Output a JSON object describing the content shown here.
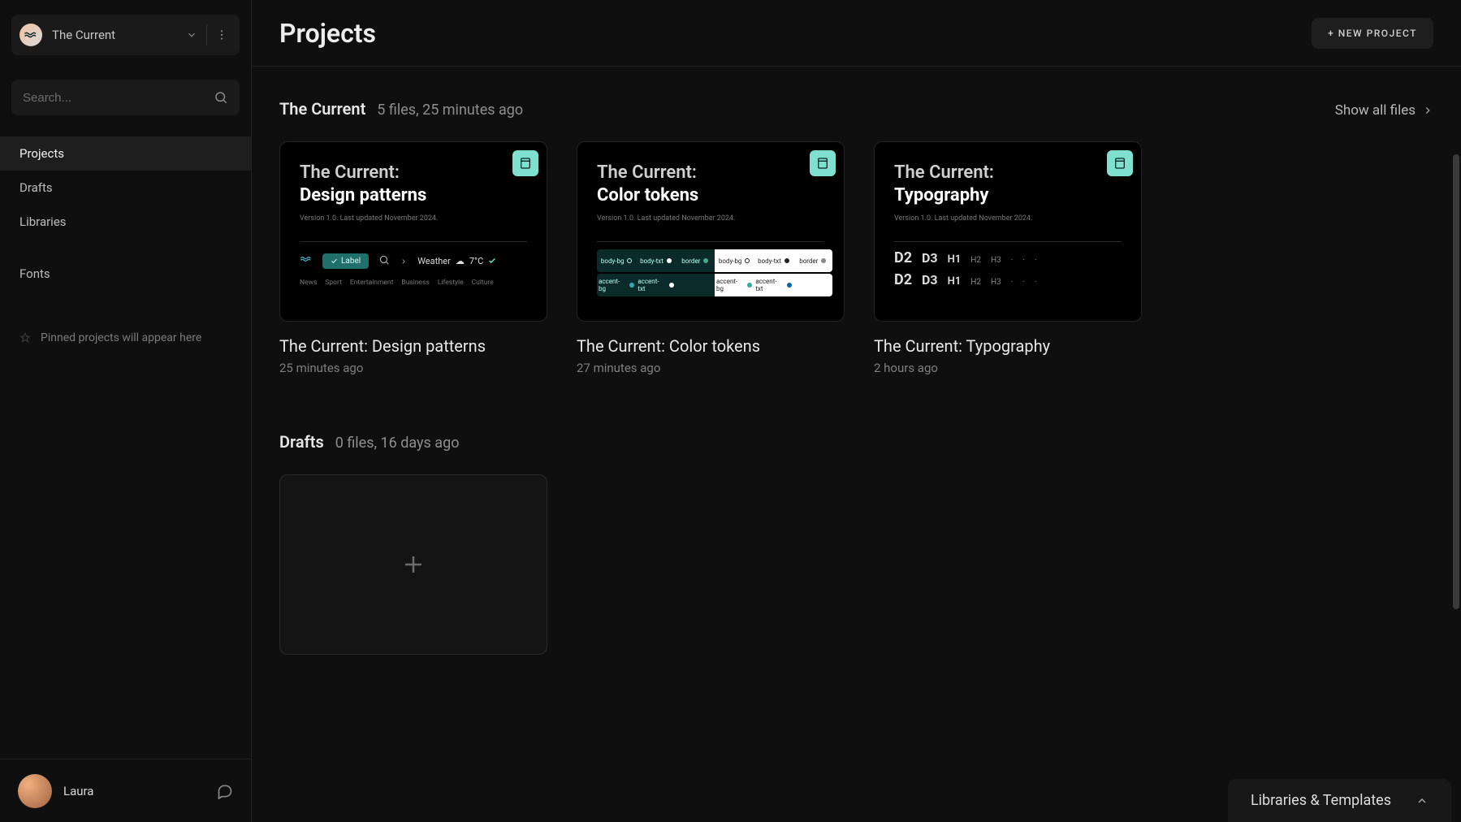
{
  "workspace": {
    "name": "The Current"
  },
  "search": {
    "placeholder": "Search..."
  },
  "nav": {
    "projects": "Projects",
    "drafts": "Drafts",
    "libraries": "Libraries",
    "fonts": "Fonts"
  },
  "pinned": {
    "empty_text": "Pinned projects will appear here"
  },
  "user": {
    "name": "Laura"
  },
  "header": {
    "title": "Projects",
    "new_project_label": "+ NEW PROJECT"
  },
  "sections": {
    "current": {
      "title": "The Current",
      "files_count": "5 files,",
      "updated": "25 minutes ago",
      "show_all": "Show all files"
    },
    "drafts": {
      "title": "Drafts",
      "files_count": "0 files,",
      "updated": "16 days ago"
    }
  },
  "cards": [
    {
      "thumb_line1": "The Current:",
      "thumb_line2": "Design patterns",
      "thumb_version": "Version 1.0. Last updated November 2024.",
      "title": "The Current: Design patterns",
      "subtitle": "25 minutes ago",
      "dp_label": "Label",
      "dp_weather": "Weather",
      "dp_temp": "7°C",
      "dp_tags": [
        "News",
        "Sport",
        "Entertainment",
        "Business",
        "Lifestyle",
        "Culture"
      ]
    },
    {
      "thumb_line1": "The Current:",
      "thumb_line2": "Color tokens",
      "thumb_version": "Version 1.0. Last updated November 2024.",
      "title": "The Current: Color tokens",
      "subtitle": "27 minutes ago",
      "swatches": [
        {
          "name": "body-bg",
          "bg": "#0b2b2a",
          "fg": "#bfe"
        },
        {
          "name": "body-txt",
          "bg": "#0b2b2a",
          "fg": "#bfe"
        },
        {
          "name": "border",
          "bg": "#0b2b2a",
          "fg": "#bfe"
        },
        {
          "name": "body-bg",
          "bg": "#ffffff",
          "fg": "#222"
        },
        {
          "name": "body-txt",
          "bg": "#ffffff",
          "fg": "#222"
        },
        {
          "name": "border",
          "bg": "#ffffff",
          "fg": "#222"
        }
      ],
      "swatches2": [
        {
          "name": "accent-bg",
          "bg": "#0b2b2a",
          "fg": "#bfe"
        },
        {
          "name": "accent-txt",
          "bg": "#0b2b2a",
          "fg": "#bfe"
        },
        {
          "name": "",
          "bg": "#0b2b2a",
          "fg": "#bfe"
        },
        {
          "name": "accent-bg",
          "bg": "#ffffff",
          "fg": "#222"
        },
        {
          "name": "accent-txt",
          "bg": "#ffffff",
          "fg": "#222"
        },
        {
          "name": "",
          "bg": "#ffffff",
          "fg": "#222"
        }
      ]
    },
    {
      "thumb_line1": "The Current:",
      "thumb_line2": "Typography",
      "thumb_version": "Version 1.0. Last updated November 2024.",
      "title": "The Current: Typography",
      "subtitle": "2 hours ago",
      "row1": [
        "D2",
        "D3",
        "H1",
        "H2",
        "H3"
      ],
      "row2": [
        "D2",
        "D3",
        "H1",
        "H2",
        "H3"
      ]
    }
  ],
  "lib_panel": {
    "label": "Libraries & Templates"
  }
}
